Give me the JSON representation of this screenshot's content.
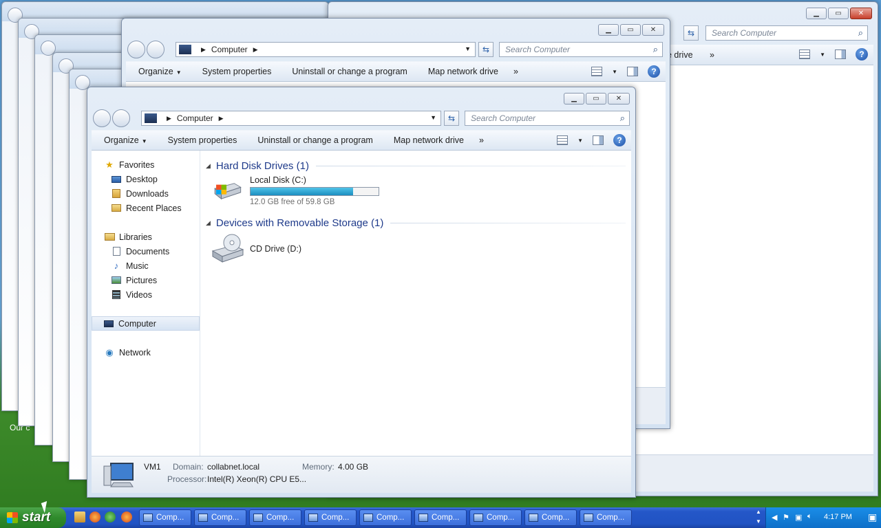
{
  "desktop": {
    "text": "Our c"
  },
  "background_window": {
    "search_placeholder": "Search Computer",
    "cmd_fragment": "e drive",
    "more": "»"
  },
  "middle_window": {
    "address": "Computer",
    "search_placeholder": "Search Computer",
    "commands": [
      "Organize",
      "System properties",
      "Uninstall or change a program",
      "Map network drive"
    ],
    "more": "»"
  },
  "window": {
    "address": "Computer",
    "search_placeholder": "Search Computer",
    "commands": {
      "organize": "Organize",
      "system_properties": "System properties",
      "uninstall": "Uninstall or change a program",
      "map_drive": "Map network drive",
      "more": "»"
    },
    "nav": {
      "favorites": "Favorites",
      "desktop": "Desktop",
      "downloads": "Downloads",
      "recent": "Recent Places",
      "libraries": "Libraries",
      "documents": "Documents",
      "music": "Music",
      "pictures": "Pictures",
      "videos": "Videos",
      "computer": "Computer",
      "network": "Network"
    },
    "groups": {
      "hdd": "Hard Disk Drives (1)",
      "removable": "Devices with Removable Storage (1)"
    },
    "drives": {
      "c_name": "Local Disk (C:)",
      "c_free": "12.0 GB free of 59.8 GB",
      "c_used_fraction": 0.8,
      "d_name": "CD Drive (D:)"
    },
    "details": {
      "name": "VM1",
      "domain_label": "Domain:",
      "domain": "collabnet.local",
      "memory_label": "Memory:",
      "memory": "4.00 GB",
      "processor_label": "Processor:",
      "processor": "Intel(R) Xeon(R) CPU E5..."
    }
  },
  "taskbar": {
    "start": "start",
    "tasks": [
      "Comp...",
      "Comp...",
      "Comp...",
      "Comp...",
      "Comp...",
      "Comp...",
      "Comp...",
      "Comp...",
      "Comp..."
    ],
    "clock": "4:17 PM"
  }
}
